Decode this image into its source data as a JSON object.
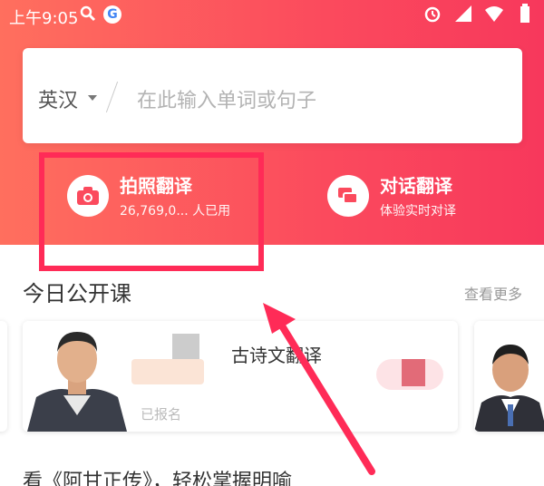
{
  "status_bar": {
    "time": "上午9:05",
    "g_letter": "G"
  },
  "search": {
    "language": "英汉",
    "placeholder": "在此输入单词或句子"
  },
  "features": {
    "photo": {
      "title": "拍照翻译",
      "subtitle": "26,769,0... 人已用"
    },
    "dialog": {
      "title": "对话翻译",
      "subtitle": "体验实时对译"
    }
  },
  "section": {
    "title": "今日公开课",
    "more": "查看更多"
  },
  "card": {
    "title": "古诗文翻译",
    "meta": "已报名"
  },
  "article": {
    "title": "看《阿甘正传》，轻松掌握明喻"
  },
  "colors": {
    "accent": "#fb4a5d",
    "highlight": "#ff2b57"
  }
}
